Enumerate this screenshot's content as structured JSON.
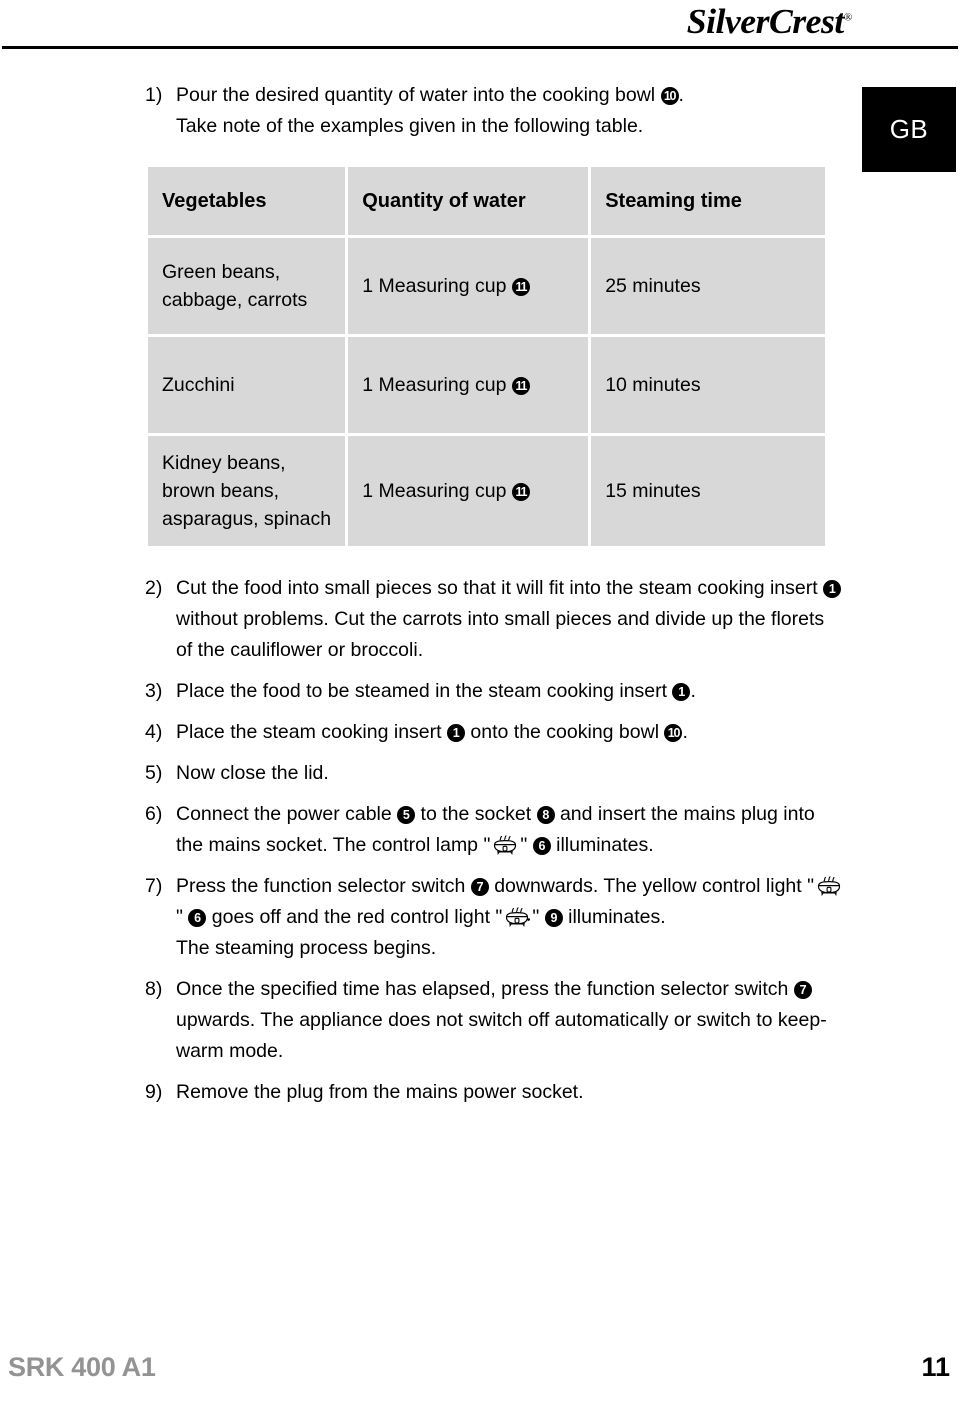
{
  "header": {
    "brand_silver": "Silver",
    "brand_crest": "Crest",
    "brand_registered": "®",
    "region_tab": "GB"
  },
  "steps": [
    {
      "number": "1)",
      "segments": [
        {
          "type": "text",
          "value": "Pour the desired quantity of water into the cooking bowl "
        },
        {
          "type": "cnum",
          "value": "10"
        },
        {
          "type": "text",
          "value": ". "
        },
        {
          "type": "break"
        },
        {
          "type": "text",
          "value": "Take note of the examples given in the following table."
        }
      ]
    },
    {
      "number": "2)",
      "segments": [
        {
          "type": "text",
          "value": "Cut the food into small pieces so that it will fit into the steam cooking insert "
        },
        {
          "type": "cnum",
          "value": "1"
        },
        {
          "type": "text",
          "value": " without problems. Cut the carrots into small pieces and divide up the florets of the cauliflower or broccoli."
        }
      ]
    },
    {
      "number": "3)",
      "segments": [
        {
          "type": "text",
          "value": "Place the food to be steamed in the steam cooking insert "
        },
        {
          "type": "cnum",
          "value": "1"
        },
        {
          "type": "text",
          "value": "."
        }
      ]
    },
    {
      "number": "4)",
      "segments": [
        {
          "type": "text",
          "value": "Place the steam cooking insert "
        },
        {
          "type": "cnum",
          "value": "1"
        },
        {
          "type": "text",
          "value": " onto the cooking bowl "
        },
        {
          "type": "cnum",
          "value": "10"
        },
        {
          "type": "text",
          "value": "."
        }
      ]
    },
    {
      "number": "5)",
      "segments": [
        {
          "type": "text",
          "value": "Now close the lid."
        }
      ]
    },
    {
      "number": "6)",
      "segments": [
        {
          "type": "text",
          "value": "Connect the power cable "
        },
        {
          "type": "cnum",
          "value": "5"
        },
        {
          "type": "text",
          "value": " to the socket "
        },
        {
          "type": "cnum",
          "value": "8"
        },
        {
          "type": "text",
          "value": " and insert the mains plug into the mains socket. The control lamp \""
        },
        {
          "type": "steam-icon",
          "value": "steamer-icon"
        },
        {
          "type": "text",
          "value": "\" "
        },
        {
          "type": "cnum",
          "value": "6"
        },
        {
          "type": "text",
          "value": " illuminates."
        }
      ]
    },
    {
      "number": "7)",
      "segments": [
        {
          "type": "text",
          "value": "Press the function selector switch "
        },
        {
          "type": "cnum",
          "value": "7"
        },
        {
          "type": "text",
          "value": " downwards. The yellow control light \""
        },
        {
          "type": "steam-icon",
          "value": "steamer-icon"
        },
        {
          "type": "text",
          "value": "\" "
        },
        {
          "type": "cnum",
          "value": "6"
        },
        {
          "type": "text",
          "value": " goes off and the red control light \""
        },
        {
          "type": "steam-icon-alt",
          "value": "steamer-hot-icon"
        },
        {
          "type": "text",
          "value": "\" "
        },
        {
          "type": "cnum",
          "value": "9"
        },
        {
          "type": "text",
          "value": " illuminates. "
        },
        {
          "type": "break"
        },
        {
          "type": "text",
          "value": "The steaming process begins."
        }
      ]
    },
    {
      "number": "8)",
      "segments": [
        {
          "type": "text",
          "value": "Once the specified time has elapsed, press the function selector switch "
        },
        {
          "type": "cnum",
          "value": "7"
        },
        {
          "type": "text",
          "value": " upwards. The appliance does not switch off automatically or switch to keep-warm mode."
        }
      ]
    },
    {
      "number": "9)",
      "segments": [
        {
          "type": "text",
          "value": "Remove the plug from the mains power socket."
        }
      ]
    }
  ],
  "table": {
    "columns": [
      "Vegetables",
      "Quantity of water",
      "Steaming time"
    ],
    "rows": [
      {
        "vegetables": "Green beans, cabbage, carrots",
        "quantity": "1 Measuring cup",
        "quantity_ref": "11",
        "time": "25 minutes",
        "tall": false
      },
      {
        "vegetables": "Zucchini",
        "quantity": "1 Measuring cup",
        "quantity_ref": "11",
        "time": "10 minutes",
        "tall": false
      },
      {
        "vegetables": "Kidney beans, brown beans, asparagus, spinach",
        "quantity": "1 Measuring cup",
        "quantity_ref": "11",
        "time": "15 minutes",
        "tall": true
      }
    ]
  },
  "footer": {
    "model": "SRK 400 A1",
    "page": "11"
  },
  "colors": {
    "cell_background": "#d8d8d8",
    "footer_model": "#939393",
    "tab_background": "#000000",
    "text": "#000000"
  }
}
